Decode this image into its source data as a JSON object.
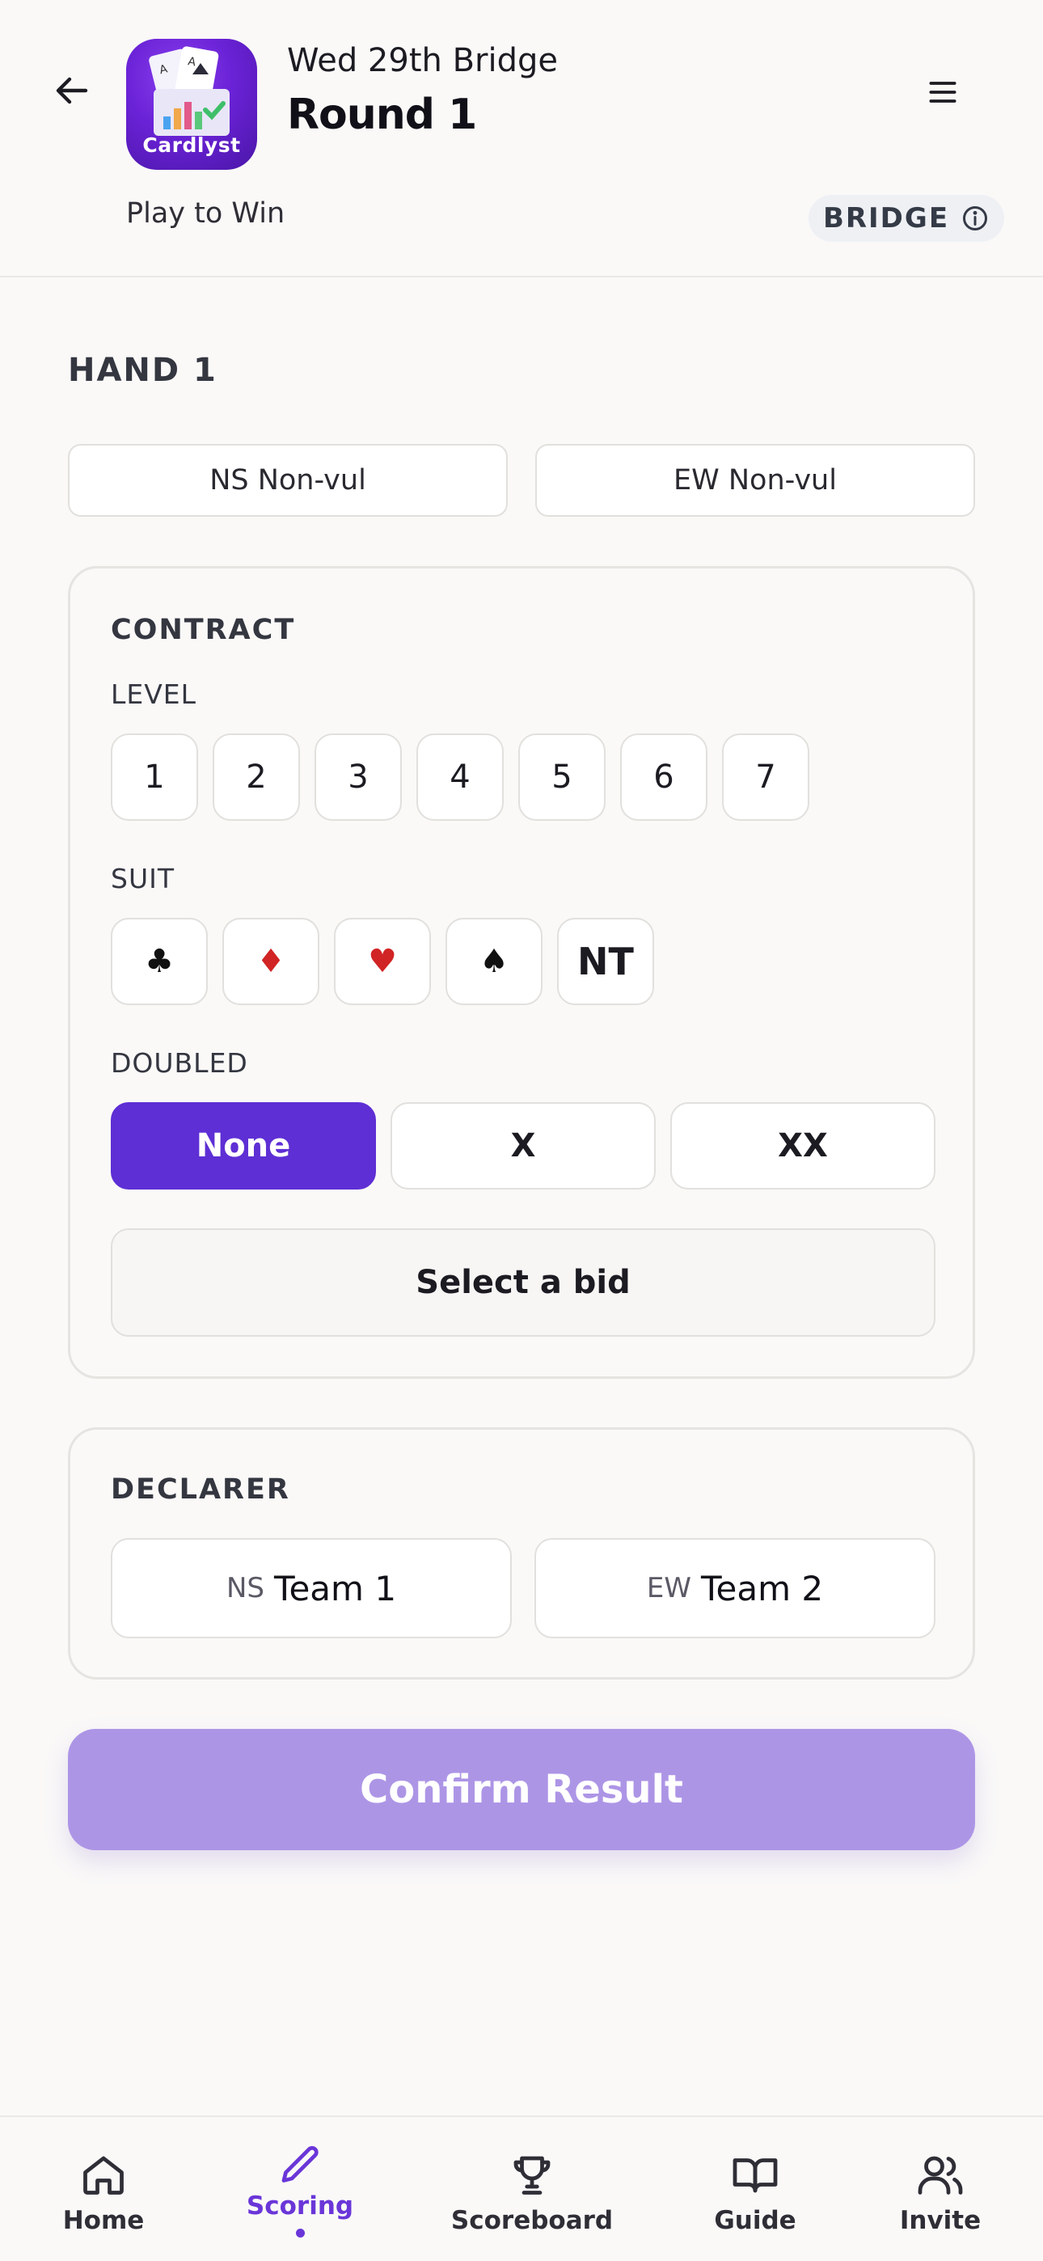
{
  "header": {
    "subtitle": "Wed 29th Bridge",
    "title": "Round 1",
    "tagline": "Play to Win",
    "badge": "BRIDGE",
    "app_icon_label": "Cardlyst"
  },
  "hand": {
    "title": "HAND 1",
    "ns_vul": "NS Non-vul",
    "ew_vul": "EW Non-vul"
  },
  "contract": {
    "title": "CONTRACT",
    "level_label": "LEVEL",
    "levels": [
      "1",
      "2",
      "3",
      "4",
      "5",
      "6",
      "7"
    ],
    "suit_label": "SUIT",
    "suits": [
      "♣",
      "♦",
      "♥",
      "♠",
      "NT"
    ],
    "doubled_label": "DOUBLED",
    "doubled_options": [
      "None",
      "X",
      "XX"
    ],
    "doubled_selected": "None",
    "bid_placeholder": "Select a bid"
  },
  "declarer": {
    "title": "DECLARER",
    "ns_side": "NS",
    "ns_team": "Team 1",
    "ew_side": "EW",
    "ew_team": "Team 2"
  },
  "confirm_label": "Confirm Result",
  "nav": {
    "items": [
      {
        "label": "Home",
        "icon": "home-icon"
      },
      {
        "label": "Scoring",
        "icon": "pencil-icon"
      },
      {
        "label": "Scoreboard",
        "icon": "trophy-icon"
      },
      {
        "label": "Guide",
        "icon": "book-icon"
      },
      {
        "label": "Invite",
        "icon": "users-icon"
      }
    ],
    "active": "Scoring"
  },
  "colors": {
    "accent": "#5e2fd4",
    "confirm_disabled": "#ad95e6",
    "suit_red": "#d12424",
    "background": "#faf9f8"
  }
}
